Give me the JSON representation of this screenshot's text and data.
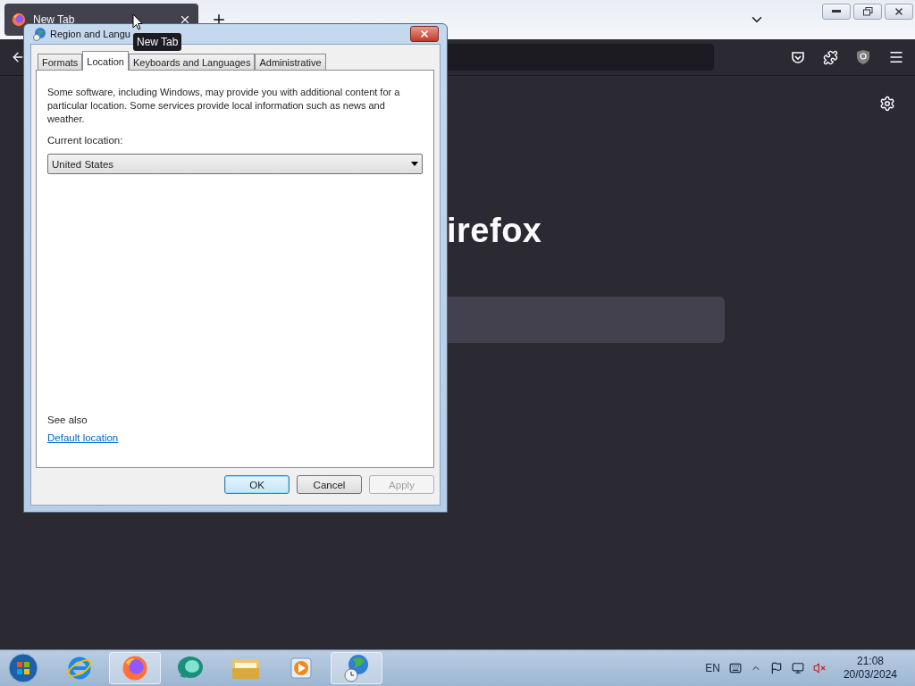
{
  "browser": {
    "tabs": [
      {
        "title": "New Tab",
        "selected": true
      }
    ],
    "tooltip": "New Tab",
    "page": {
      "brand": "irefox"
    }
  },
  "dialog": {
    "title": "Region and Langu",
    "tabs": [
      {
        "label": "Formats",
        "selected": false
      },
      {
        "label": "Location",
        "selected": true
      },
      {
        "label": "Keyboards and Languages",
        "selected": false
      },
      {
        "label": "Administrative",
        "selected": false
      }
    ],
    "description": "Some software, including Windows, may provide you with additional content for a particular location. Some services provide local information such as news and weather.",
    "location_label": "Current location:",
    "location_select": {
      "value": "United States"
    },
    "see_also": "See also",
    "link": "Default location",
    "buttons": [
      {
        "label": "OK",
        "kind": "default",
        "disabled": false
      },
      {
        "label": "Cancel",
        "kind": "normal",
        "disabled": false
      },
      {
        "label": "Apply",
        "kind": "normal",
        "disabled": true
      }
    ]
  },
  "taskbar": {
    "items": [
      {
        "kind": "ie",
        "active": false
      },
      {
        "kind": "firefox",
        "active": true
      },
      {
        "kind": "chat",
        "active": false
      },
      {
        "kind": "explorer",
        "active": false
      },
      {
        "kind": "media",
        "active": false
      },
      {
        "kind": "globe",
        "active": true
      }
    ],
    "language": "EN",
    "time": "21:08",
    "date": "20/03/2024"
  }
}
